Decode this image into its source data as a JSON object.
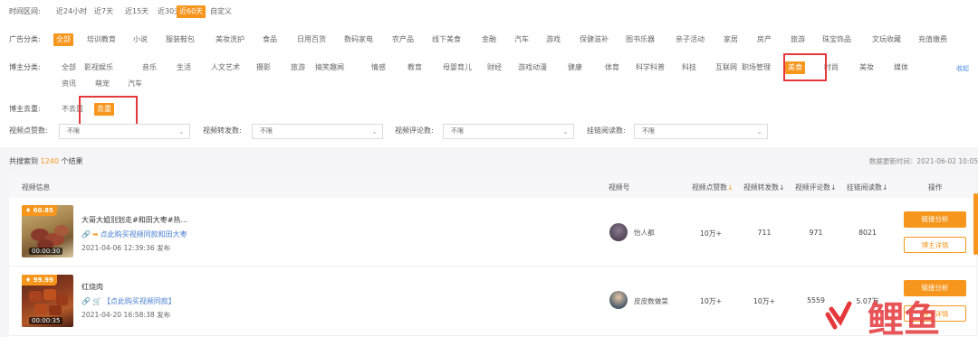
{
  "filters": {
    "time": {
      "label": "时间区间:",
      "options": [
        "近24小时",
        "近7天",
        "近15天",
        "近30天",
        "近60天",
        "自定义"
      ],
      "active": 4
    },
    "ad": {
      "label": "广告分类:",
      "options": [
        "全部",
        "培训教育",
        "小说",
        "服装鞋包",
        "美妆洗护",
        "食品",
        "日用百货",
        "数码家电",
        "农产品",
        "线下美食",
        "金融",
        "汽车",
        "游戏",
        "保健滋补",
        "图书乐器",
        "亲子活动",
        "家居",
        "房产",
        "旅游",
        "珠宝饰品",
        "文玩收藏",
        "充值缴费"
      ],
      "active": 0
    },
    "blogger": {
      "label": "博主分类:",
      "options_row1": [
        "全部",
        "影视娱乐",
        "音乐",
        "生活",
        "人文艺术",
        "摄影",
        "旅游",
        "搞笑趣闻",
        "情感",
        "教育",
        "母婴育儿",
        "财经",
        "游戏动漫",
        "健康",
        "体育",
        "科学科普",
        "科技",
        "互联网",
        "职场管理",
        "美食",
        "时尚",
        "美妆",
        "媒体"
      ],
      "options_row2": [
        "资讯",
        "萌宠",
        "汽车"
      ],
      "active": "美食",
      "collapse": "收起"
    },
    "dedupe": {
      "label": "博主去重:",
      "options": [
        "不去重",
        "去重"
      ],
      "active": 1
    },
    "dropdowns": [
      {
        "label": "视频点赞数:",
        "value": "不限"
      },
      {
        "label": "视频转发数:",
        "value": "不限"
      },
      {
        "label": "视频评论数:",
        "value": "不限"
      },
      {
        "label": "挂链阅读数:",
        "value": "不限"
      }
    ]
  },
  "results": {
    "prefix": "共搜索到",
    "count": "1240",
    "suffix": "个结果",
    "updated": "数据更新时间：2021-06-02 10:05"
  },
  "table": {
    "headers": {
      "info": "视频信息",
      "account": "视频号",
      "likes": "视频点赞数",
      "shares": "视频转发数",
      "comments": "视频评论数",
      "reads": "挂链阅读数",
      "ops": "操作"
    },
    "sort_arrow": "↓",
    "rows": [
      {
        "score": "60.85",
        "duration": "00:00:30",
        "title": "大哥大姐别划走#和田大枣#热...",
        "link": "点此购买视频同款和田大枣",
        "date": "2021-04-06 12:39:36 发布",
        "account": "怡人都",
        "likes": "10万+",
        "shares": "711",
        "comments": "971",
        "reads": "8021",
        "btn1": "链接分析",
        "btn2": "博主详情"
      },
      {
        "score": "99.99",
        "duration": "00:00:35",
        "title": "红烧肉",
        "link": "【点此购买视频同款】",
        "date": "2021-04-20 16:58:38 发布",
        "account": "皮皮数做菜",
        "likes": "10万+",
        "shares": "10万+",
        "comments": "5559",
        "reads": "5.07万",
        "btn1": "链接分析",
        "btn2": "博主详情"
      }
    ]
  },
  "watermark": "鲤鱼",
  "colors": {
    "accent": "#f7961d",
    "highlight_box": "#e5383c",
    "link": "#4a7fcf"
  }
}
